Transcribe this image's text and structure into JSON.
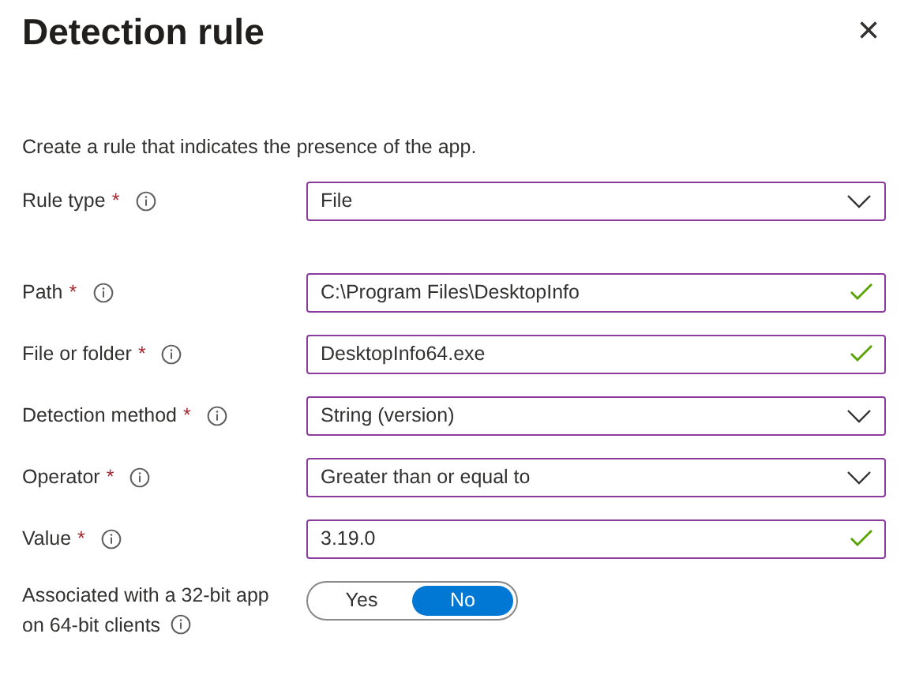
{
  "panel": {
    "title": "Detection rule",
    "close": "×"
  },
  "description": "Create a rule that indicates the presence of the app.",
  "fields": [
    {
      "label": "Rule type",
      "required_mark": "*",
      "kind": "select",
      "value": "File"
    },
    {
      "label": "Path",
      "required_mark": "*",
      "kind": "text",
      "value": "C:\\Program Files\\DesktopInfo",
      "valid": true
    },
    {
      "label": "File or folder",
      "required_mark": "*",
      "kind": "text",
      "value": "DesktopInfo64.exe",
      "valid": true
    },
    {
      "label": "Detection method",
      "required_mark": "*",
      "kind": "select",
      "value": "String (version)"
    },
    {
      "label": "Operator",
      "required_mark": "*",
      "kind": "select",
      "value": "Greater than or equal to"
    },
    {
      "label": "Value",
      "required_mark": "*",
      "kind": "text",
      "value": "3.19.0",
      "valid": true
    }
  ],
  "toggle": {
    "label_lines": [
      "Associated with a 32-bit app",
      "on 64-bit clients"
    ],
    "options": [
      {
        "label": "Yes",
        "selected": false
      },
      {
        "label": "No",
        "selected": true
      }
    ]
  }
}
